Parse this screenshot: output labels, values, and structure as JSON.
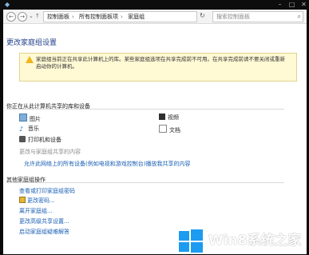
{
  "toolbar": {
    "breadcrumb": [
      "控制面板",
      "所有控制面板项",
      "家庭组"
    ],
    "search_placeholder": "搜索控制面板"
  },
  "page": {
    "title": "更改家庭组设置",
    "warning": "家庭组当前正在共享此计算机上的库。某些家庭组选项在共享完成前不可用。在共享完成前请不要关闭或重新启动你的计算机。"
  },
  "sharing": {
    "section_title": "你正在从此计算机共享的库和设备",
    "items": [
      {
        "label": "图片",
        "icon": "pictures-icon"
      },
      {
        "label": "视频",
        "icon": "video-icon"
      },
      {
        "label": "音乐",
        "icon": "music-icon"
      },
      {
        "label": "文档",
        "icon": "documents-icon"
      },
      {
        "label": "打印机和设备",
        "icon": "printer-icon"
      }
    ],
    "change_link": "更改与家庭组共享的内容",
    "allow_link": "允许此网络上的所有设备(例如电视和游戏控制台)播放我共享的内容"
  },
  "other": {
    "section_title": "其他家庭组操作",
    "actions": [
      "查看或打印家庭组密码",
      "更改密码...",
      "离开家庭组...",
      "更改高级共享设置...",
      "启动家庭组疑难解答"
    ]
  },
  "watermark": {
    "text": "Win8系统之家"
  },
  "colors": {
    "link": "#1a5fb4",
    "title": "#1e3f8a",
    "warning_bg": "#fff9d4",
    "warning_icon": "#f0b51b"
  }
}
